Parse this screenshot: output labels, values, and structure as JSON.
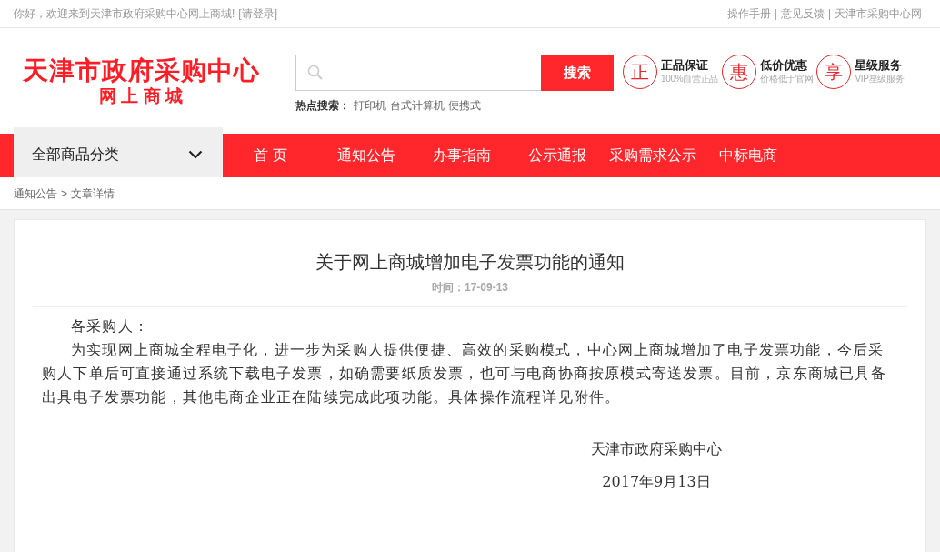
{
  "top_bar": {
    "welcome": "你好，欢迎来到天津市政府采购中心网上商城!",
    "login_link": "[请登录]",
    "links": [
      "操作手册",
      "意见反馈",
      "天津市采购中心网"
    ],
    "separator": "|"
  },
  "header": {
    "logo": {
      "title": "天津市政府采购中心",
      "subtitle": "网 上 商 城"
    },
    "search": {
      "button": "搜索",
      "hot_label": "热点搜索：",
      "hot_terms": [
        "打印机",
        "台式计算机",
        "便携式"
      ]
    },
    "promises": [
      {
        "badge": "正",
        "title": "正品保证",
        "subtitle": "100%自营正品"
      },
      {
        "badge": "惠",
        "title": "低价优惠",
        "subtitle": "价格低于官网"
      },
      {
        "badge": "享",
        "title": "星级服务",
        "subtitle": "VIP星级服务"
      }
    ]
  },
  "nav": {
    "category": "全部商品分类",
    "items": [
      {
        "label": "首 页",
        "selected": false
      },
      {
        "label": "通知公告",
        "selected": false
      },
      {
        "label": "办事指南",
        "selected": false
      },
      {
        "label": "公示通报",
        "selected": false
      },
      {
        "label": "采购需求公示",
        "selected": false
      },
      {
        "label": "中标电商",
        "selected": false
      }
    ]
  },
  "breadcrumb": [
    "通知公告",
    "文章详情"
  ],
  "breadcrumb_separator": ">",
  "article": {
    "title": "关于网上商城增加电子发票功能的通知",
    "time": "时间：17-09-13",
    "paragraphs": [
      "各采购人：",
      "为实现网上商城全程电子化，进一步为采购人提供便捷、高效的采购模式，中心网上商城增加了电子发票功能，今后采购人下单后可直接通过系统下载电子发票，如确需要纸质发票，也可与电商协商按原模式寄送发票。目前，京东商城已具备出具电子发票功能，其他电商企业正在陆续完成此项功能。具体操作流程详见附件。"
    ],
    "signature": "天津市政府采购中心",
    "date": "2017年9月13日"
  }
}
